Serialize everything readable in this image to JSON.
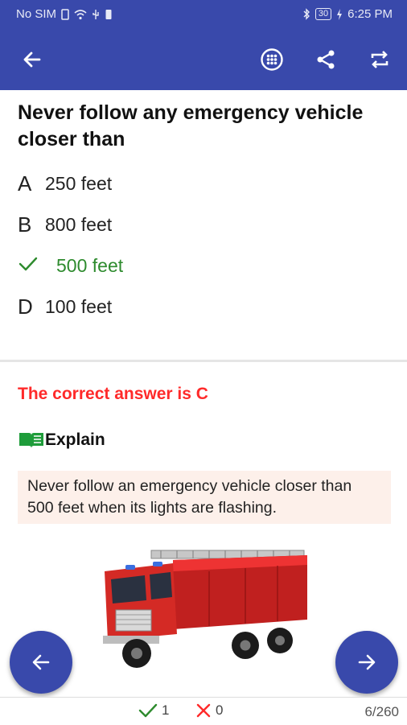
{
  "status_bar": {
    "carrier": "No SIM",
    "battery": "30",
    "time": "6:25 PM"
  },
  "app_bar": {
    "back_icon": "arrow-left-icon",
    "grid_icon": "grid-circle-icon",
    "share_icon": "share-icon",
    "repeat_icon": "repeat-icon"
  },
  "question": {
    "text": "Never follow any emergency vehicle closer than"
  },
  "options": [
    {
      "letter": "A",
      "text": "250 feet"
    },
    {
      "letter": "B",
      "text": "800 feet"
    },
    {
      "letter": "C",
      "text": "500 feet",
      "correct": true
    },
    {
      "letter": "D",
      "text": "100 feet"
    }
  ],
  "answer": {
    "correct_text": "The correct answer is C",
    "explain_label": "Explain",
    "explanation": "Never follow an emergency vehicle closer than 500 feet when its lights are flashing."
  },
  "image": {
    "subject": "fire-truck"
  },
  "footer": {
    "correct_count": "1",
    "wrong_count": "0",
    "progress": "6/260"
  },
  "colors": {
    "primary": "#3949ab",
    "correct": "#2e8b2e",
    "wrong": "#ff2a2a",
    "explain_bg": "#fdf0ea"
  }
}
